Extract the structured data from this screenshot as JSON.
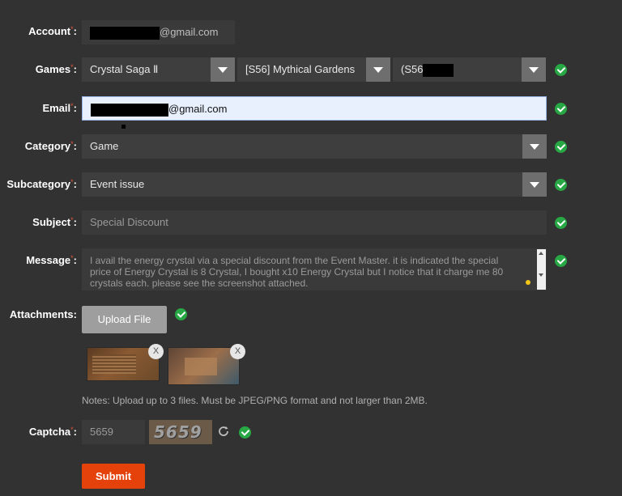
{
  "labels": {
    "account": "Account",
    "games": "Games",
    "email": "Email",
    "category": "Category",
    "subcategory": "Subcategory",
    "subject": "Subject",
    "message": "Message",
    "attachments": "Attachments:",
    "captcha": "Captcha",
    "required_mark": "*",
    "colon": ":"
  },
  "account": {
    "suffix": "@gmail.com"
  },
  "games": {
    "game": "Crystal Saga Ⅱ",
    "server": "[S56] Mythical Gardens",
    "character_prefix": "(S56"
  },
  "email": {
    "suffix": "@gmail.com"
  },
  "category": {
    "value": "Game"
  },
  "subcategory": {
    "value": "Event issue"
  },
  "subject": {
    "value": "Special Discount"
  },
  "message": {
    "value": "I avail the energy crystal via a special discount from the Event Master. it is indicated the special price of Energy Crystal is 8 Crystal, I bought x10 Energy Crystal but I notice that it charge me 80 crystals each. please see the screenshot attached."
  },
  "attachments": {
    "upload_label": "Upload File",
    "remove_label": "X",
    "notes": "Notes: Upload up to 3 files. Must be JPEG/PNG format and not larger than 2MB."
  },
  "captcha": {
    "value": "5659",
    "image_text": "5659"
  },
  "submit_label": "Submit",
  "colors": {
    "accent": "#e5410a",
    "valid": "#27a844",
    "focus_field": "#e8f0fe"
  },
  "icons": [
    "check-icon",
    "chevron-down-icon",
    "refresh-icon",
    "close-icon",
    "scroll-up-icon",
    "scroll-down-icon"
  ]
}
